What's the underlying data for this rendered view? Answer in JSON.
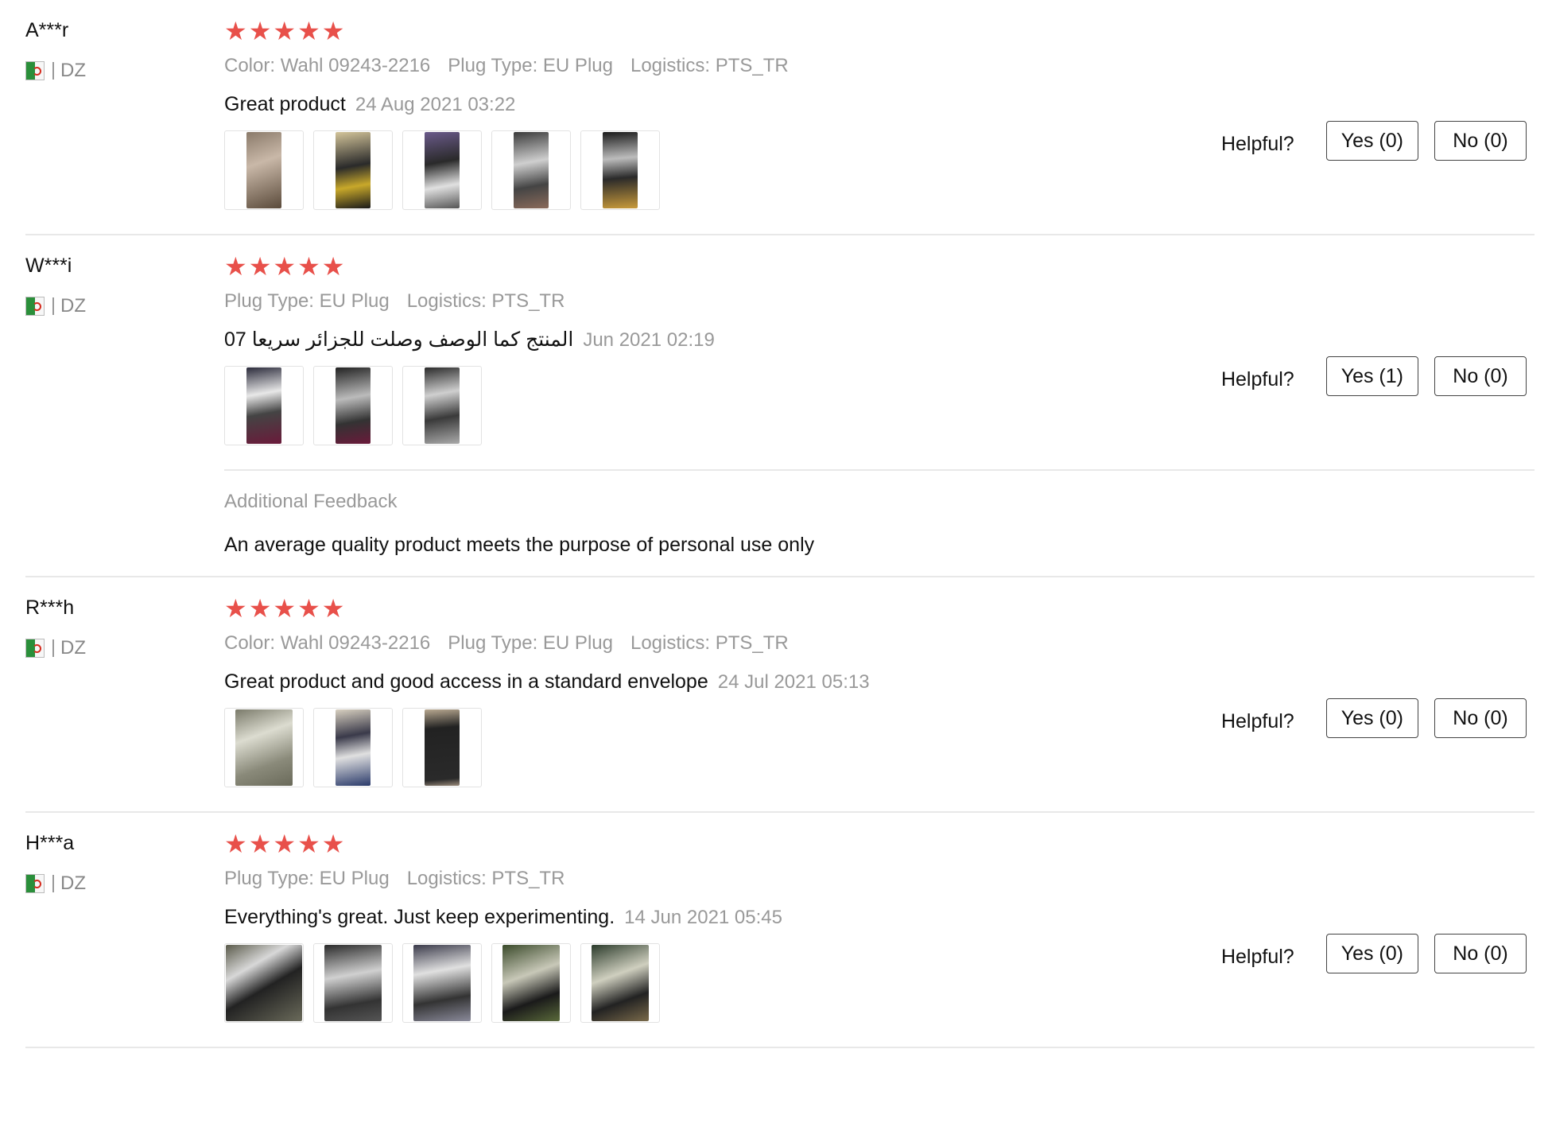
{
  "reviews": [
    {
      "user": "A***r",
      "country": "DZ",
      "rating": 5,
      "attributes": [
        {
          "label": "Color:",
          "value": "Wahl 09243-2216"
        },
        {
          "label": "Plug Type:",
          "value": "EU Plug"
        },
        {
          "label": "Logistics:",
          "value": "PTS_TR"
        }
      ],
      "content": "Great product",
      "date": "24 Aug 2021 03:22",
      "images": [
        "photo",
        "photo",
        "photo",
        "photo",
        "photo"
      ],
      "helpful_label": "Helpful?",
      "yes_label": "Yes (0)",
      "no_label": "No (0)"
    },
    {
      "user": "W***i",
      "country": "DZ",
      "rating": 5,
      "attributes": [
        {
          "label": "Plug Type:",
          "value": "EU Plug"
        },
        {
          "label": "Logistics:",
          "value": "PTS_TR"
        }
      ],
      "content": "07 المنتج كما الوصف وصلت للجزائر سريعا",
      "date": "Jun 2021 02:19",
      "images": [
        "photo",
        "photo",
        "photo"
      ],
      "helpful_label": "Helpful?",
      "yes_label": "Yes (1)",
      "no_label": "No (0)",
      "additional_feedback": {
        "title": "Additional Feedback",
        "text": "An average quality product meets the purpose of personal use only"
      }
    },
    {
      "user": "R***h",
      "country": "DZ",
      "rating": 5,
      "attributes": [
        {
          "label": "Color:",
          "value": "Wahl 09243-2216"
        },
        {
          "label": "Plug Type:",
          "value": "EU Plug"
        },
        {
          "label": "Logistics:",
          "value": "PTS_TR"
        }
      ],
      "content": "Great product and good access in a standard envelope",
      "date": "24 Jul 2021 05:13",
      "images": [
        "photo",
        "photo",
        "photo"
      ],
      "helpful_label": "Helpful?",
      "yes_label": "Yes (0)",
      "no_label": "No (0)"
    },
    {
      "user": "H***a",
      "country": "DZ",
      "rating": 5,
      "attributes": [
        {
          "label": "Plug Type:",
          "value": "EU Plug"
        },
        {
          "label": "Logistics:",
          "value": "PTS_TR"
        }
      ],
      "content": "Everything's great. Just keep experimenting.",
      "date": "14 Jun 2021 05:45",
      "images": [
        "photo",
        "photo",
        "photo",
        "photo",
        "photo"
      ],
      "helpful_label": "Helpful?",
      "yes_label": "Yes (0)",
      "no_label": "No (0)"
    }
  ],
  "colors": {
    "star": "#e8504a",
    "muted_text": "#999999",
    "divider": "#e8e8e8"
  },
  "icons": {
    "star": "star-icon",
    "flag": "algeria-flag-icon"
  }
}
